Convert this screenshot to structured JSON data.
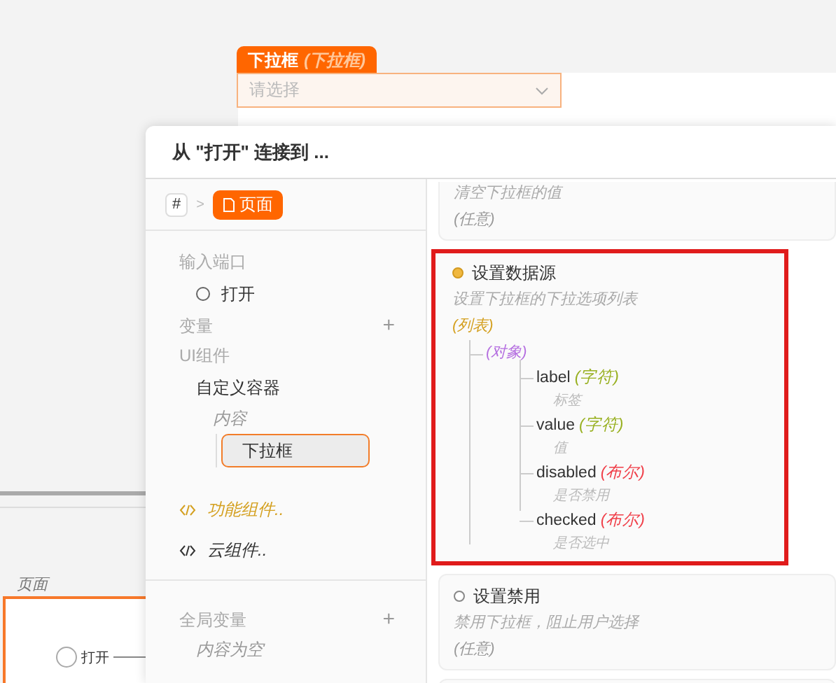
{
  "canvas": {
    "component_tag": {
      "name": "下拉框",
      "type": "(下拉框)"
    },
    "dropdown": {
      "placeholder": "请选择"
    },
    "page_label": "页面",
    "page_port": "打开"
  },
  "dialog": {
    "title": "从 \"打开\" 连接到 ...",
    "breadcrumb_separator": ">",
    "breadcrumb": [
      {
        "label": "#",
        "kind": "hash",
        "selected": false
      },
      {
        "label": "页面",
        "kind": "page",
        "selected": true
      }
    ],
    "input_ports": {
      "title": "输入端口",
      "items": [
        {
          "label": "打开"
        }
      ]
    },
    "variables": {
      "title": "变量",
      "add": "+"
    },
    "ui_components": {
      "title": "UI组件",
      "items": [
        {
          "label": "自定义容器",
          "kind": "component",
          "selected": false,
          "children": [
            {
              "label": "内容",
              "kind": "slot",
              "selected": false,
              "children": [
                {
                  "label": "下拉框",
                  "kind": "component",
                  "selected": true
                }
              ]
            }
          ]
        }
      ]
    },
    "code_groups": [
      {
        "label": "功能组件..",
        "color": "#d4a020"
      },
      {
        "label": "云组件..",
        "color": "#333333"
      }
    ],
    "global_variables": {
      "title": "全局变量",
      "add": "+",
      "empty": "内容为空"
    },
    "ports": [
      {
        "description": "清空下拉框的值",
        "type": {
          "label": "(任意)",
          "kind": "any"
        },
        "highlighted": false
      },
      {
        "name": "设置数据源",
        "description": "设置下拉框的下拉选项列表",
        "connected": true,
        "highlighted": true,
        "type": {
          "label": "(列表)",
          "kind": "list",
          "children": [
            {
              "label": "(对象)",
              "kind": "object",
              "children": [
                {
                  "name": "label",
                  "label": "(字符)",
                  "kind": "string",
                  "description": "标签"
                },
                {
                  "name": "value",
                  "label": "(字符)",
                  "kind": "string",
                  "description": "值"
                },
                {
                  "name": "disabled",
                  "label": "(布尔)",
                  "kind": "boolean",
                  "description": "是否禁用"
                },
                {
                  "name": "checked",
                  "label": "(布尔)",
                  "kind": "boolean",
                  "description": "是否选中"
                }
              ]
            }
          ]
        }
      },
      {
        "name": "设置禁用",
        "description": "禁用下拉框，阻止用户选择",
        "type": {
          "label": "(任意)",
          "kind": "any"
        },
        "connected": false,
        "highlighted": false
      }
    ]
  }
}
